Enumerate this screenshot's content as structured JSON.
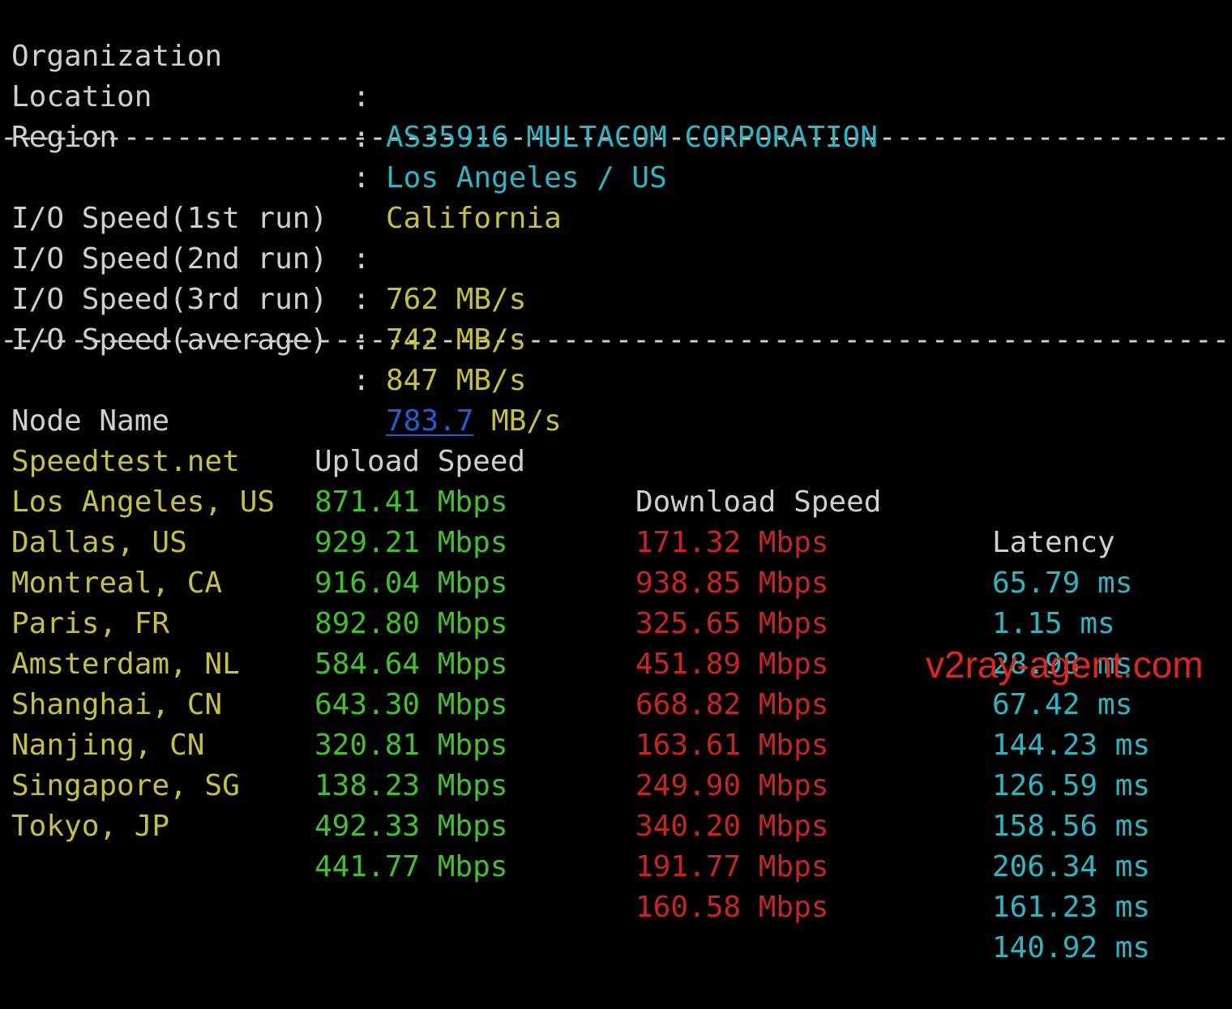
{
  "info": {
    "organization": {
      "label": "Organization",
      "value": "AS35916 MULTACOM CORPORATION"
    },
    "location": {
      "label": "Location",
      "value": "Los Angeles / US"
    },
    "region": {
      "label": "Region",
      "value": "California"
    }
  },
  "separator": "------------------------------------------------------------------------",
  "colon": ":",
  "io": {
    "run1": {
      "label": "I/O Speed(1st run)",
      "value": "762 MB/s"
    },
    "run2": {
      "label": "I/O Speed(2nd run)",
      "value": "742 MB/s"
    },
    "run3": {
      "label": "I/O Speed(3rd run)",
      "value": "847 MB/s"
    },
    "average": {
      "label": "I/O Speed(average)",
      "number": "783.7",
      "unit": "MB/s"
    }
  },
  "table": {
    "headers": {
      "node": "Node Name",
      "upload": "Upload Speed",
      "download": "Download Speed",
      "latency": "Latency"
    },
    "rows": [
      {
        "node": "Speedtest.net",
        "upload": "871.41 Mbps",
        "download": "171.32 Mbps",
        "latency": "65.79 ms"
      },
      {
        "node": "Los Angeles, US",
        "upload": "929.21 Mbps",
        "download": "938.85 Mbps",
        "latency": "1.15 ms"
      },
      {
        "node": "Dallas, US",
        "upload": "916.04 Mbps",
        "download": "325.65 Mbps",
        "latency": "28.98 ms"
      },
      {
        "node": "Montreal, CA",
        "upload": "892.80 Mbps",
        "download": "451.89 Mbps",
        "latency": "67.42 ms"
      },
      {
        "node": "Paris, FR",
        "upload": "584.64 Mbps",
        "download": "668.82 Mbps",
        "latency": "144.23 ms"
      },
      {
        "node": "Amsterdam, NL",
        "upload": "643.30 Mbps",
        "download": "163.61 Mbps",
        "latency": "126.59 ms"
      },
      {
        "node": "Shanghai, CN",
        "upload": "320.81 Mbps",
        "download": "249.90 Mbps",
        "latency": "158.56 ms"
      },
      {
        "node": "Nanjing, CN",
        "upload": "138.23 Mbps",
        "download": "340.20 Mbps",
        "latency": "206.34 ms"
      },
      {
        "node": "Singapore, SG",
        "upload": "492.33 Mbps",
        "download": "191.77 Mbps",
        "latency": "161.23 ms"
      },
      {
        "node": "Tokyo, JP",
        "upload": "441.77 Mbps",
        "download": "160.58 Mbps",
        "latency": "140.92 ms"
      }
    ]
  },
  "watermark": "v2ray-agent.com",
  "colors": {
    "background": "#000000",
    "label": "#cfcfcf",
    "cyan": "#2ab7c4",
    "yellow": "#c6c13a",
    "green": "#3fc22a",
    "red": "#c9241e",
    "link_blue": "#1f5fd1",
    "watermark": "#e0261c"
  }
}
